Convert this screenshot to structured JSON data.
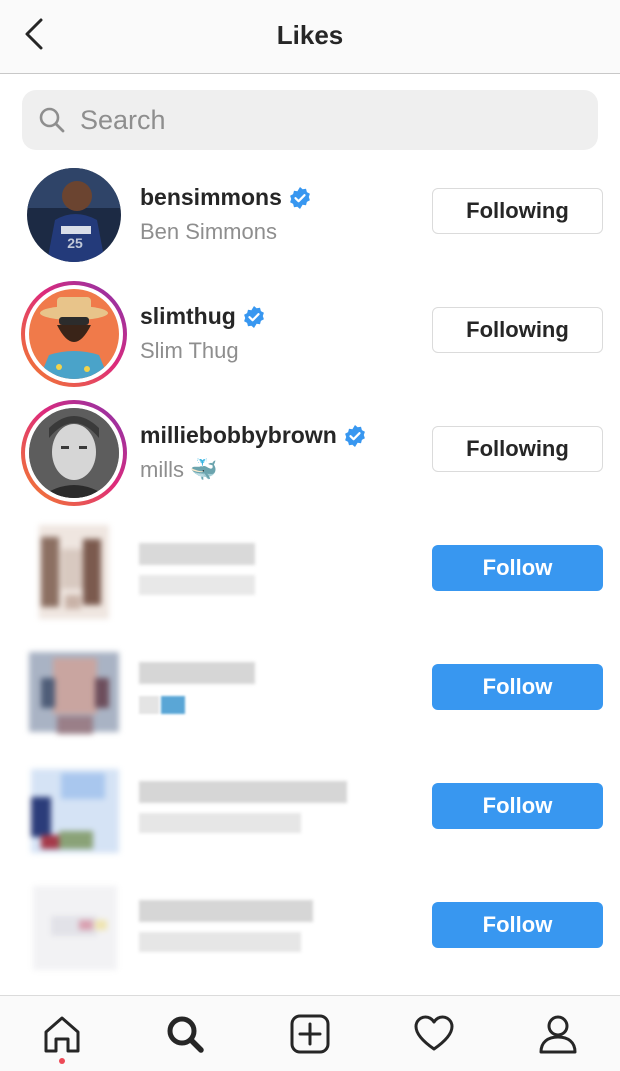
{
  "header": {
    "title": "Likes"
  },
  "search": {
    "placeholder": "Search"
  },
  "users": [
    {
      "username": "bensimmons",
      "fullname": "Ben Simmons",
      "verified": true,
      "button": "Following"
    },
    {
      "username": "slimthug",
      "fullname": "Slim Thug",
      "verified": true,
      "button": "Following"
    },
    {
      "username": "milliebobbybrown",
      "fullname": "mills",
      "fullname_emoji": "🐳",
      "verified": true,
      "button": "Following"
    },
    {
      "button": "Follow"
    },
    {
      "button": "Follow"
    },
    {
      "button": "Follow"
    },
    {
      "button": "Follow"
    }
  ],
  "colors": {
    "accent": "#3897f0",
    "verified": "#3897f0",
    "notification_dot": "#ed4956",
    "story_ring_start": "#f58529",
    "story_ring_end": "#8134af"
  },
  "icons": {
    "back": "chevron-left-icon",
    "search": "search-icon",
    "verified": "verified-badge-icon",
    "nav": [
      "home-icon",
      "search-icon",
      "add-icon",
      "heart-icon",
      "profile-icon"
    ]
  }
}
